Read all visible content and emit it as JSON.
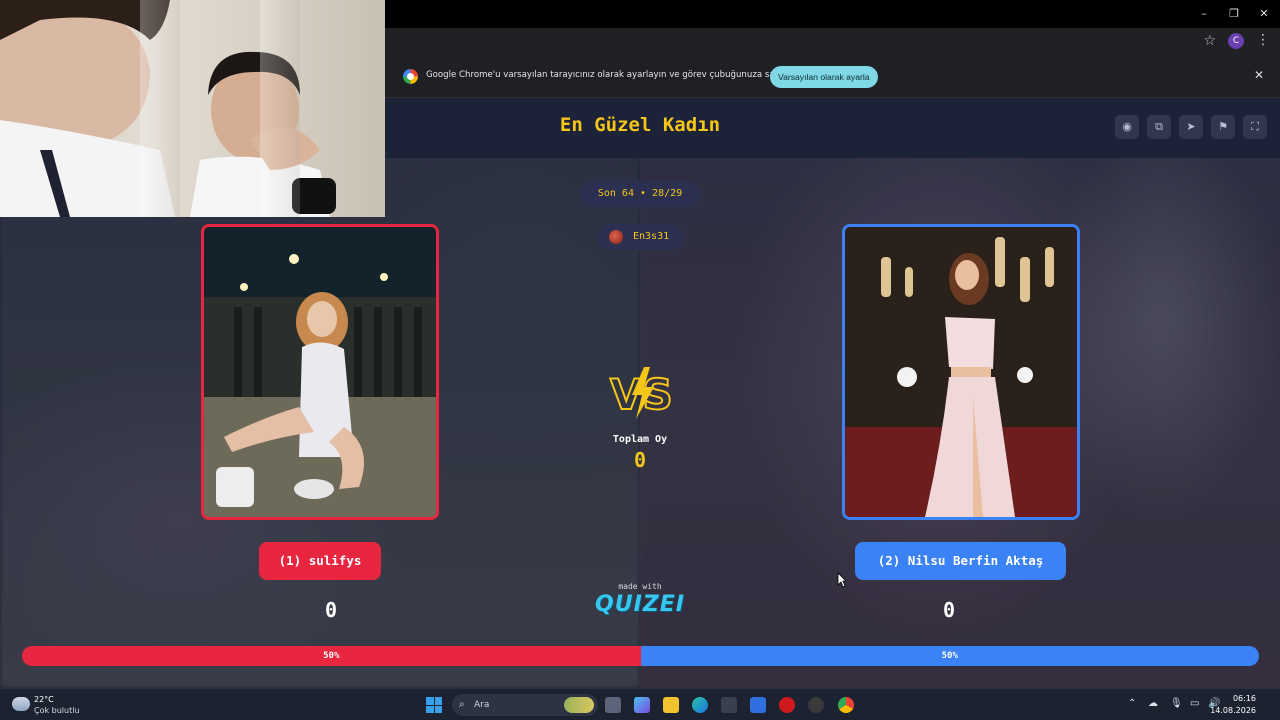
{
  "browser": {
    "window_controls": [
      "–",
      "❐",
      "✕"
    ],
    "profile_initial": "C",
    "infobar": {
      "message": "Google Chrome'u varsayılan tarayıcınız olarak ayarlayın ve görev çubuğunuza sabitleyin",
      "action_label": "Varsayılan olarak ayarla"
    }
  },
  "quiz": {
    "title": "En Güzel Kadın",
    "round_label": "Son 64 • 28/29",
    "creator": "En3s31",
    "total_votes_label": "Toplam Oy",
    "total_votes": "0",
    "left": {
      "name": "(1) sulifys",
      "score": "0",
      "percent_label": "50%",
      "share": 0.5
    },
    "right": {
      "name": "(2) Nilsu Berfin Aktaş",
      "score": "0",
      "percent_label": "50%",
      "share": 0.5
    },
    "made_with": "made with",
    "brand": "QUIZEI"
  },
  "colors": {
    "left": "#e8263f",
    "right": "#3b82f6",
    "accent": "#f5c518"
  },
  "header_icons": [
    "eye-icon",
    "share-icon",
    "send-icon",
    "flag-icon",
    "fullscreen-icon"
  ],
  "taskbar": {
    "temperature": "22°C",
    "weather": "Çok bulutlu",
    "search_placeholder": "Ara",
    "time": "06:16",
    "date": "14.08.2026"
  }
}
